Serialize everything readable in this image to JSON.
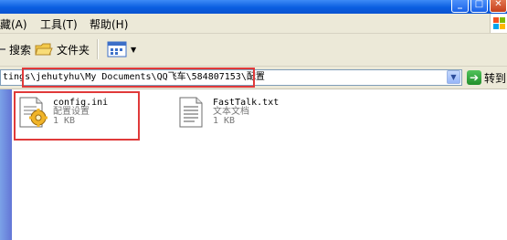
{
  "menu": {
    "favorites": "藏(A)",
    "tools": "工具(T)",
    "help": "帮助(H)"
  },
  "toolbar": {
    "search": "搜索",
    "folders": "文件夹"
  },
  "address": {
    "path": "tings\\jehutyhu\\My Documents\\QQ飞车\\584807153\\配置",
    "go_label": "转到"
  },
  "files": [
    {
      "name": "config.ini",
      "type": "配置设置",
      "size": "1 KB"
    },
    {
      "name": "FastTalk.txt",
      "type": "文本文档",
      "size": "1 KB"
    }
  ],
  "colors": {
    "highlight": "#e03a3a",
    "chrome": "#ece9d8",
    "title_blue": "#0a5ee0"
  }
}
